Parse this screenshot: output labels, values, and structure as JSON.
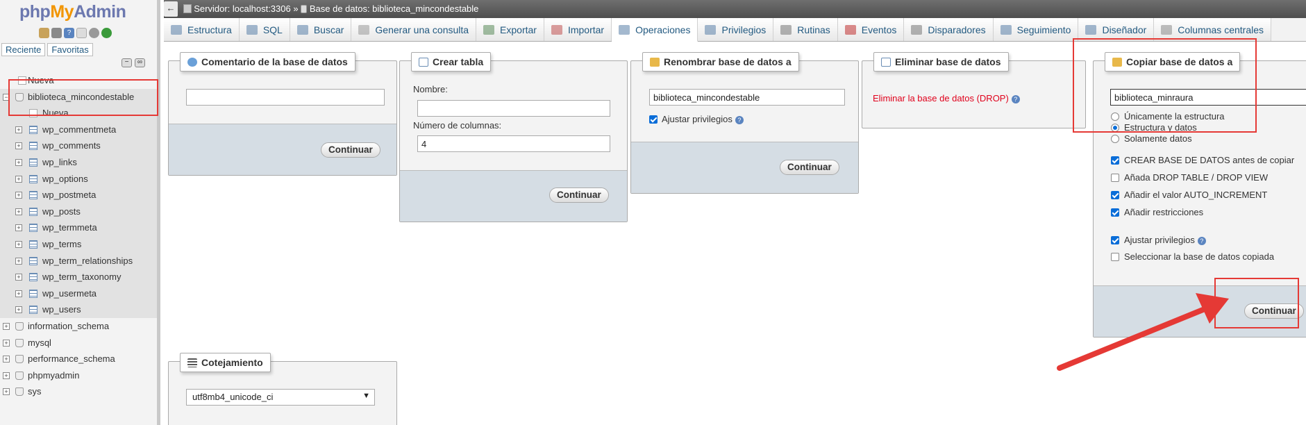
{
  "sidebar": {
    "logo": {
      "php": "php",
      "my": "My",
      "admin": "Admin"
    },
    "tabs": [
      "Reciente",
      "Favoritas"
    ],
    "tree": {
      "new_top": "Nueva",
      "selected_db": "biblioteca_mincondestable",
      "new_table": "Nueva",
      "tables": [
        "wp_commentmeta",
        "wp_comments",
        "wp_links",
        "wp_options",
        "wp_postmeta",
        "wp_posts",
        "wp_termmeta",
        "wp_terms",
        "wp_term_relationships",
        "wp_term_taxonomy",
        "wp_usermeta",
        "wp_users"
      ],
      "other_dbs": [
        "information_schema",
        "mysql",
        "performance_schema",
        "phpmyadmin",
        "sys"
      ]
    }
  },
  "topbar": {
    "back": "←",
    "server": "Servidor: localhost:3306",
    "sep": "»",
    "database": "Base de datos: biblioteca_mincondestable"
  },
  "tabs": [
    "Estructura",
    "SQL",
    "Buscar",
    "Generar una consulta",
    "Exportar",
    "Importar",
    "Operaciones",
    "Privilegios",
    "Rutinas",
    "Eventos",
    "Disparadores",
    "Seguimiento",
    "Diseñador",
    "Columnas centrales"
  ],
  "active_tab": "Operaciones",
  "panels": {
    "comment": {
      "title": "Comentario de la base de datos",
      "value": "",
      "button": "Continuar"
    },
    "create_table": {
      "title": "Crear tabla",
      "name_label": "Nombre:",
      "name_value": "",
      "cols_label": "Número de columnas:",
      "cols_value": "4",
      "button": "Continuar"
    },
    "rename": {
      "title": "Renombrar base de datos a",
      "value": "biblioteca_mincondestable",
      "adjust_label": "Ajustar privilegios",
      "button": "Continuar"
    },
    "drop": {
      "title": "Eliminar base de datos",
      "link": "Eliminar la base de datos (DROP)"
    },
    "copy": {
      "title": "Copiar base de datos a",
      "value": "biblioteca_minraura",
      "radio_structure": "Únicamente la estructura",
      "radio_structure_data": "Estructura y datos",
      "radio_data": "Solamente datos",
      "opt_create": "CREAR BASE DE DATOS antes de copiar",
      "opt_drop": "Añada DROP TABLE / DROP VIEW",
      "opt_autoinc": "Añadir el valor AUTO_INCREMENT",
      "opt_constraints": "Añadir restricciones",
      "opt_adjust": "Ajustar privilegios",
      "opt_select": "Seleccionar la base de datos copiada",
      "button": "Continuar"
    },
    "collation": {
      "title": "Cotejamiento",
      "value": "utf8mb4_unicode_ci"
    }
  },
  "colors": {
    "accent": "#235a81",
    "annotation": "#e53935",
    "danger": "#e0001b"
  }
}
